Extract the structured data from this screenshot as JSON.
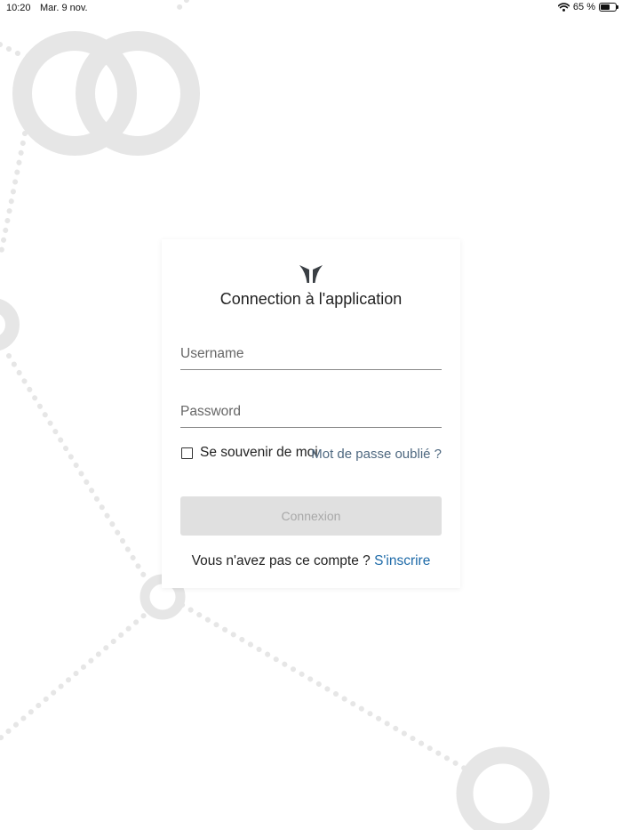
{
  "status_bar": {
    "time": "10:20",
    "date": "Mar. 9 nov.",
    "battery": "65 %",
    "battery_level": 0.65,
    "icons": [
      "wifi-icon",
      "battery-icon"
    ]
  },
  "login": {
    "logo": "app-logo-icon",
    "title": "Connection à l'application",
    "username_placeholder": "Username",
    "password_placeholder": "Password",
    "remember_label": "Se souvenir de moi",
    "remember_checked": false,
    "forgot_password": "Mot de passe oublié ?",
    "submit_label": "Connexion",
    "submit_disabled": true,
    "signup_prompt": "Vous n'avez pas ce compte ?",
    "signup_link": "S'inscrire"
  },
  "colors": {
    "background": "#ffffff",
    "decoration": "#e6e6e6",
    "link": "#1d6aa8",
    "forgot_link": "#4e6880",
    "button_disabled_bg": "#e0e0e0",
    "button_disabled_text": "#a8a8a8"
  }
}
